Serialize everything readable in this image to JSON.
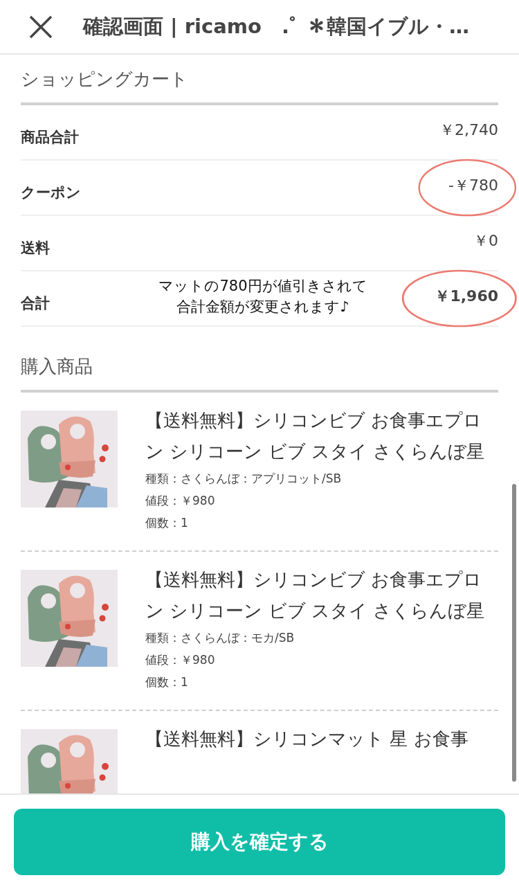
{
  "header": {
    "title": "確認画面 | ricamo　.ﾟ ＊韓国イブル・…"
  },
  "cart": {
    "heading": "ショッピングカート",
    "rows": [
      {
        "label": "商品合計",
        "value": "￥2,740",
        "circled": false,
        "bold": false
      },
      {
        "label": "クーポン",
        "value": "-￥780",
        "circled": true,
        "bold": false
      },
      {
        "label": "送料",
        "value": "￥0",
        "circled": false,
        "bold": false
      },
      {
        "label": "合計",
        "value": "￥1,960",
        "circled": true,
        "bold": true,
        "note": [
          "マットの780円が値引きされて",
          "合計金額が変更されます♪"
        ]
      }
    ]
  },
  "products": {
    "heading": "購入商品",
    "items": [
      {
        "kind": "picture",
        "title": "【送料無料】シリコンビブ お食事エプロン シリコーン ビブ スタイ さくらんぼ星",
        "details": [
          "種類：さくらんぼ：アプリコット/SB",
          "値段：￥980",
          "個数：1"
        ]
      },
      {
        "kind": "picture",
        "title": "【送料無料】シリコンビブ お食事エプロン シリコーン ビブ スタイ さくらんぼ星",
        "details": [
          "種類：さくらんぼ：モカ/SB",
          "値段：￥980",
          "個数：1"
        ]
      },
      {
        "kind": "picture",
        "title": "【送料無料】シリコンマット 星 お食事"
      }
    ]
  },
  "footer": {
    "button": "購入を確定する"
  }
}
